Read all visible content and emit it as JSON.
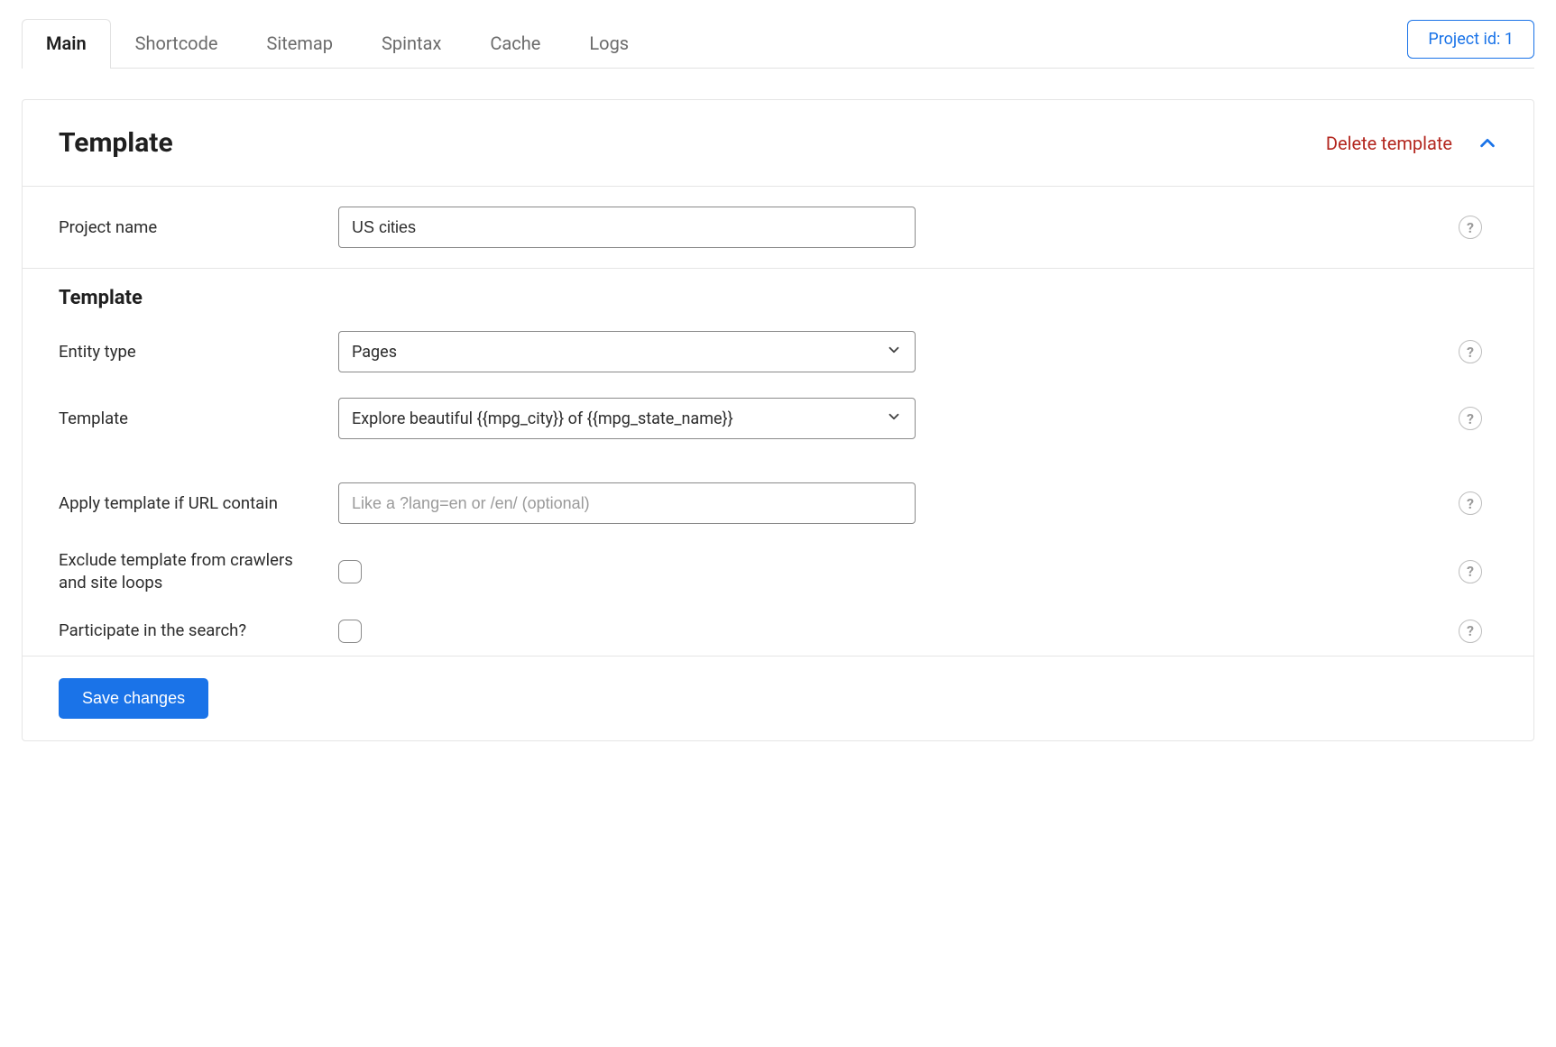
{
  "tabs": [
    {
      "label": "Main"
    },
    {
      "label": "Shortcode"
    },
    {
      "label": "Sitemap"
    },
    {
      "label": "Spintax"
    },
    {
      "label": "Cache"
    },
    {
      "label": "Logs"
    }
  ],
  "project_badge": "Project id: 1",
  "panel": {
    "title": "Template",
    "delete_label": "Delete template",
    "section_heading": "Template"
  },
  "fields": {
    "project_name": {
      "label": "Project name",
      "value": "US cities"
    },
    "entity_type": {
      "label": "Entity type",
      "value": "Pages"
    },
    "template": {
      "label": "Template",
      "value": "Explore beautiful {{mpg_city}} of {{mpg_state_name}}"
    },
    "url_contain": {
      "label": "Apply template if URL contain",
      "placeholder": "Like a ?lang=en or /en/ (optional)",
      "value": ""
    },
    "exclude": {
      "label": "Exclude template from crawlers and site loops",
      "checked": false
    },
    "participate": {
      "label": "Participate in the search?",
      "checked": false
    }
  },
  "buttons": {
    "save": "Save changes"
  },
  "help_glyph": "?"
}
